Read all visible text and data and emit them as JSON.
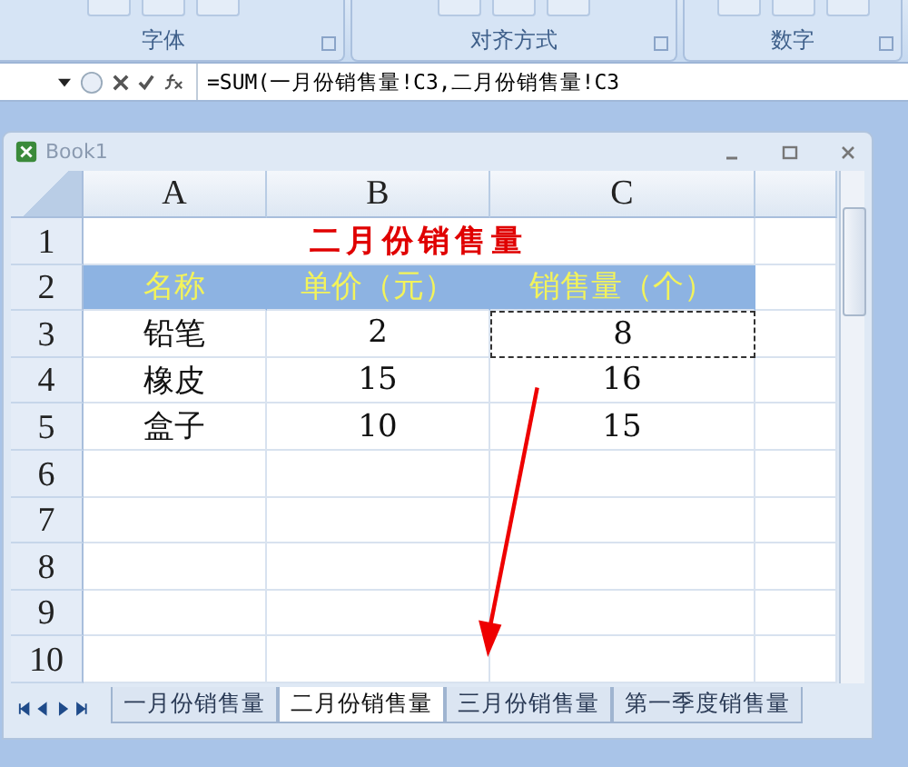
{
  "ribbon": {
    "groups": [
      {
        "label": "字体"
      },
      {
        "label": "对齐方式"
      },
      {
        "label": "数字"
      }
    ]
  },
  "formula_bar": {
    "value": "=SUM(一月份销售量!C3,二月份销售量!C3"
  },
  "window": {
    "title": "Book1"
  },
  "sheet": {
    "columns": [
      "A",
      "B",
      "C"
    ],
    "rows": [
      {
        "header": "1",
        "kind": "title",
        "cells": [
          {
            "text": "二月份销售量",
            "marquee": false
          }
        ]
      },
      {
        "header": "2",
        "kind": "header",
        "cells": [
          {
            "text": "名称",
            "marquee": false
          },
          {
            "text": "单价（元）",
            "marquee": false
          },
          {
            "text": "销售量（个）",
            "marquee": false
          }
        ]
      },
      {
        "header": "3",
        "kind": "data",
        "cells": [
          {
            "text": "铅笔",
            "marquee": false
          },
          {
            "text": "2",
            "marquee": false
          },
          {
            "text": "8",
            "marquee": true
          }
        ]
      },
      {
        "header": "4",
        "kind": "data",
        "cells": [
          {
            "text": "橡皮",
            "marquee": false
          },
          {
            "text": "15",
            "marquee": false
          },
          {
            "text": "16",
            "marquee": false
          }
        ]
      },
      {
        "header": "5",
        "kind": "data",
        "cells": [
          {
            "text": "盒子",
            "marquee": false
          },
          {
            "text": "10",
            "marquee": false
          },
          {
            "text": "15",
            "marquee": false
          }
        ]
      },
      {
        "header": "6",
        "kind": "data"
      },
      {
        "header": "7",
        "kind": "data"
      },
      {
        "header": "8",
        "kind": "data"
      },
      {
        "header": "9",
        "kind": "data"
      },
      {
        "header": "10",
        "kind": "data"
      }
    ]
  },
  "sheet_tabs": [
    {
      "label": "一月份销售量",
      "selected": false
    },
    {
      "label": "二月份销售量",
      "selected": true
    },
    {
      "label": "三月份销售量",
      "selected": false
    },
    {
      "label": "第一季度销售量",
      "selected": false
    }
  ]
}
